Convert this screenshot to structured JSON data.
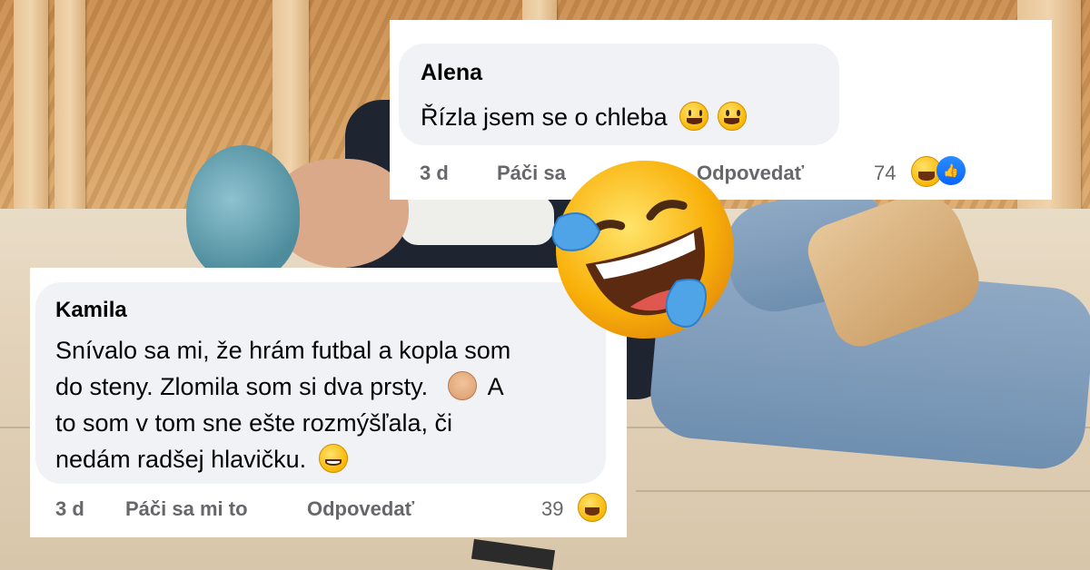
{
  "comments": [
    {
      "author": "Alena",
      "text_lines": [
        "Řízla jsem se o chleba"
      ],
      "time": "3 d",
      "like_label": "Páči sa",
      "reply_label": "Odpovedať",
      "reaction_count": "74",
      "reactions": [
        "laugh-icon",
        "like-icon"
      ]
    },
    {
      "author": "Kamila",
      "text_lines": [
        "Snívalo sa mi, že hrám futbal a kopla som",
        "do steny. Zlomila som si dva prsty.",
        "to som v tom sne ešte rozmýšľala, či",
        "nedám radšej hlavičku."
      ],
      "shrug_trailing": "A",
      "time": "3 d",
      "like_label": "Páči sa mi to",
      "reply_label": "Odpovedať",
      "reaction_count": "39",
      "reactions": [
        "laugh-icon"
      ]
    }
  ],
  "colors": {
    "card_bg": "#ffffff",
    "bubble_bg": "#f0f2f5",
    "meta_gray": "#65676b",
    "text": "#050505",
    "like_blue": "#0866ff"
  },
  "overlay_emoji": "face-with-tears-of-joy-icon"
}
